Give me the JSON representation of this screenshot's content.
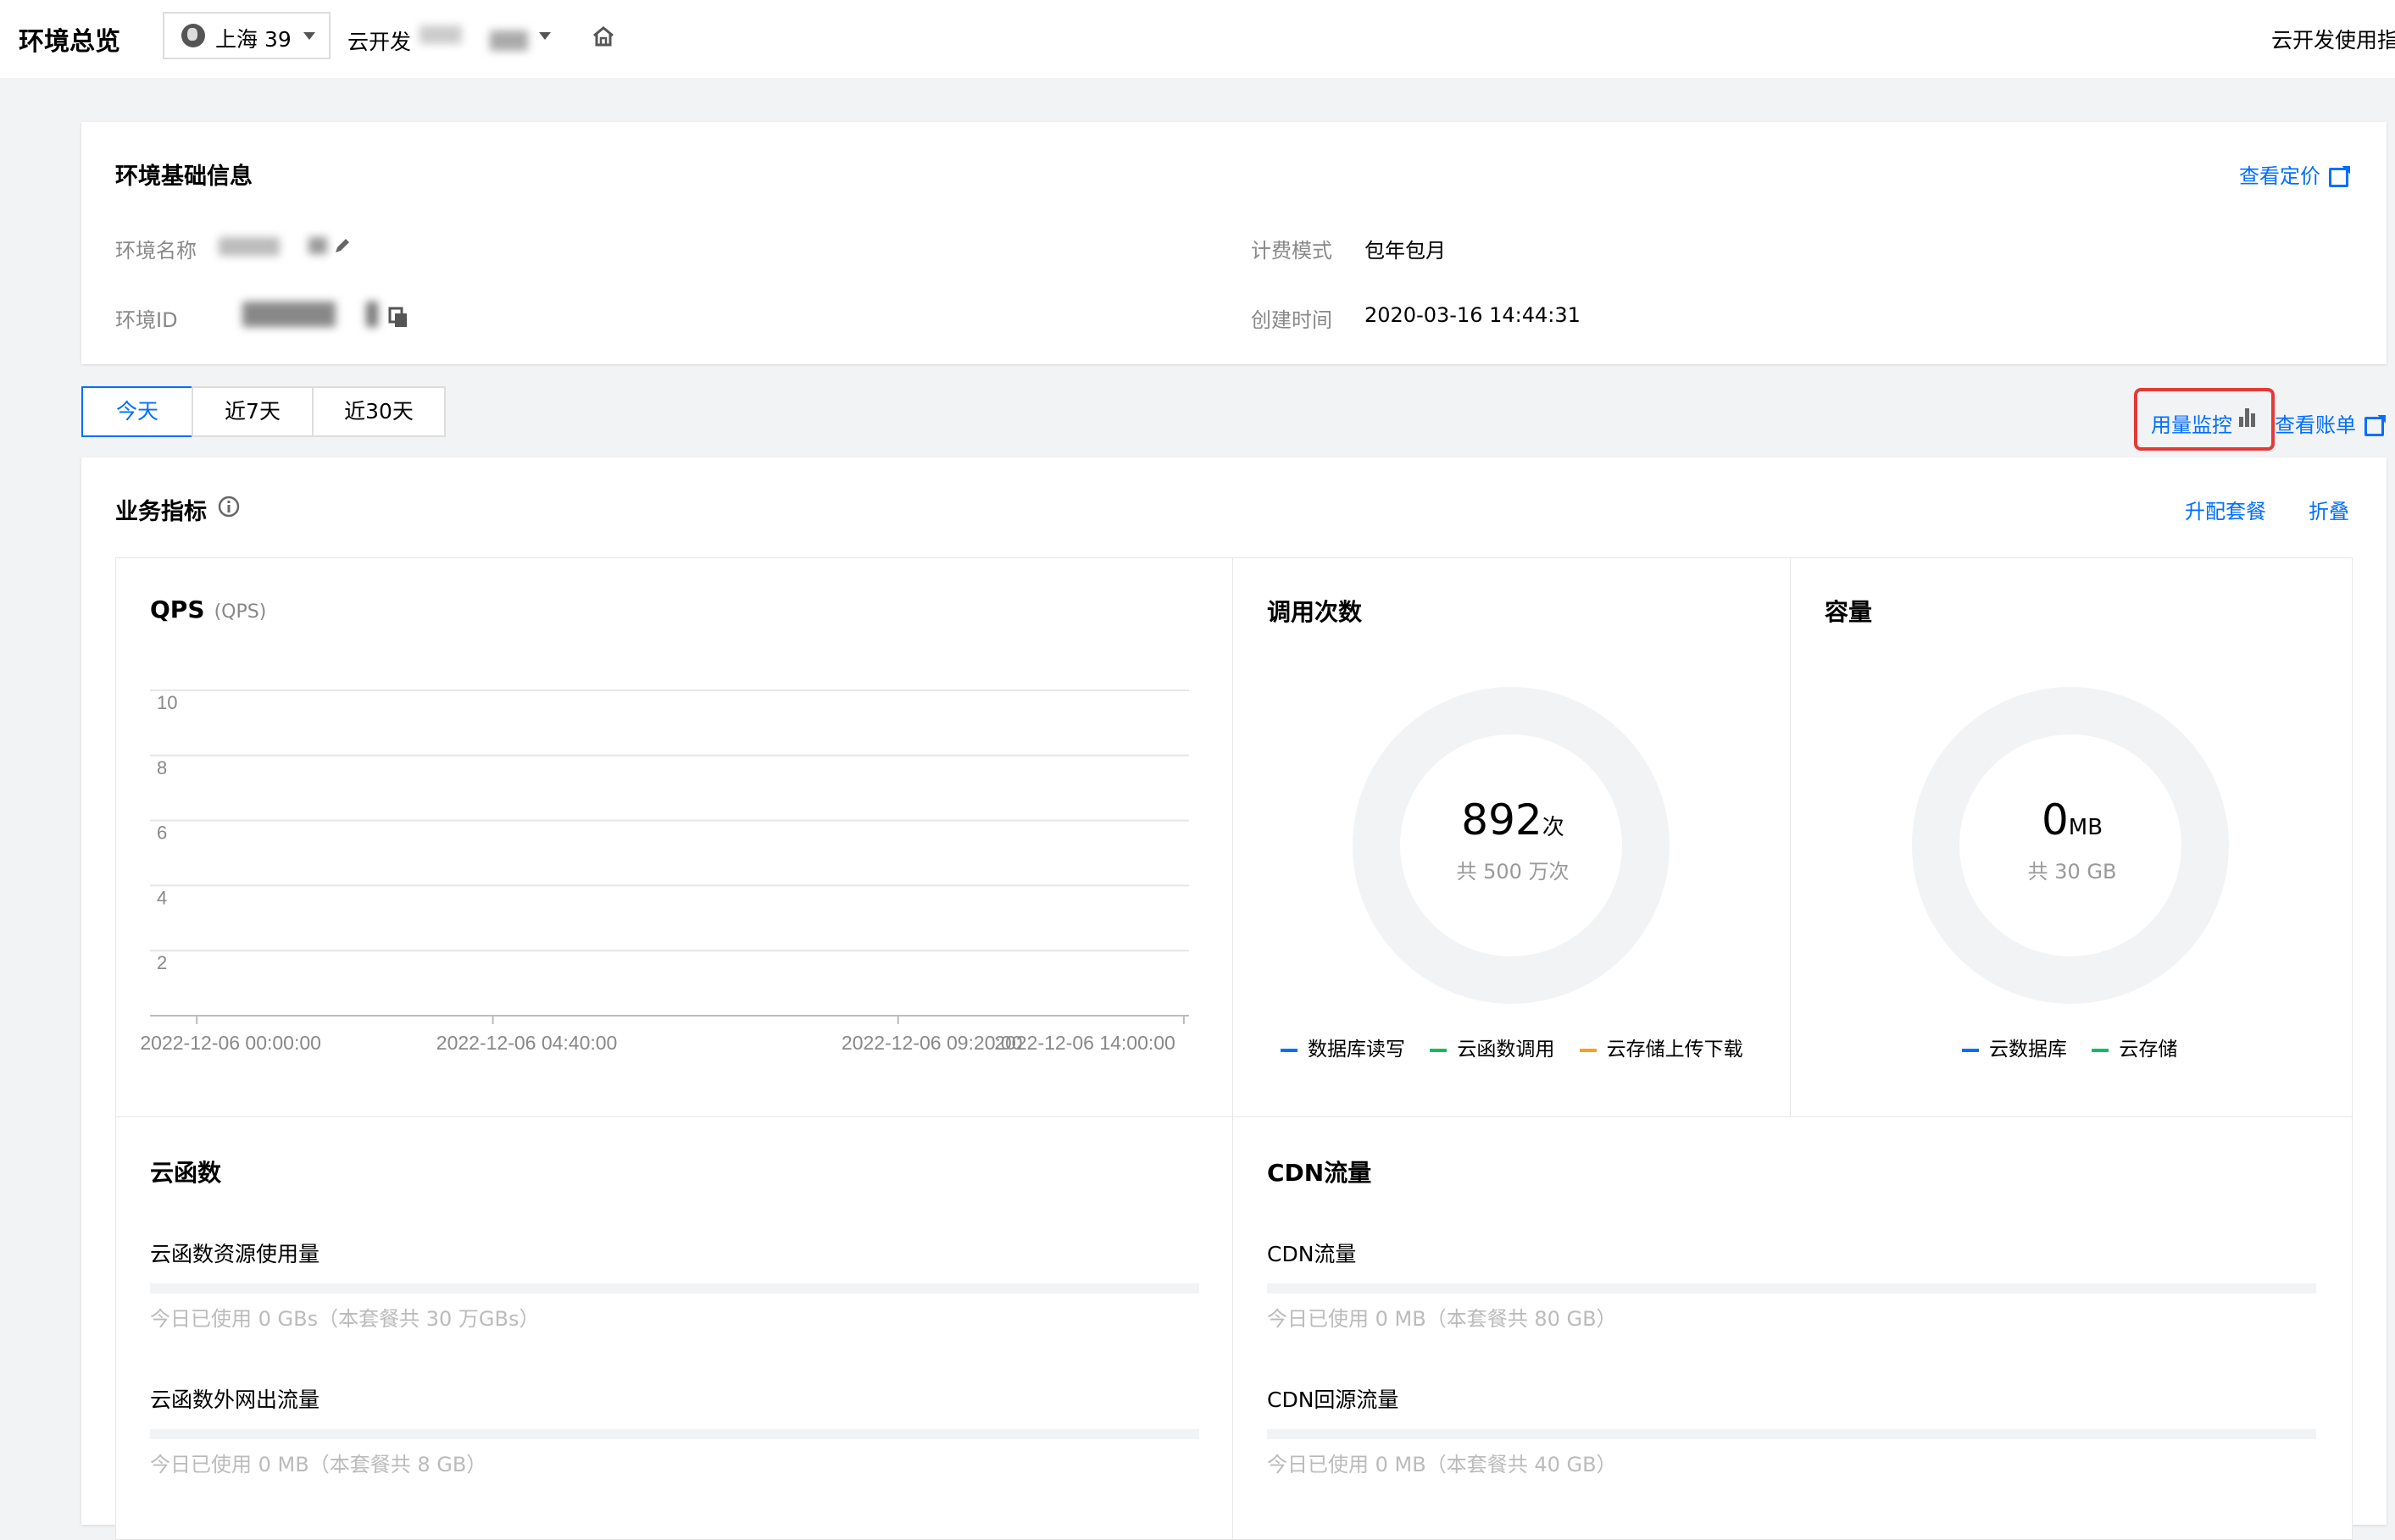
{
  "header": {
    "title": "环境总览",
    "region": "上海 39",
    "env_label": "云开发",
    "guide_link": "云开发使用指"
  },
  "basic_info": {
    "title": "环境基础信息",
    "pricing_link": "查看定价",
    "env_name_label": "环境名称",
    "env_id_label": "环境ID",
    "billing_label": "计费模式",
    "billing_value": "包年包月",
    "created_label": "创建时间",
    "created_value": "2020-03-16 14:44:31"
  },
  "tabs": [
    "今天",
    "近7天",
    "近30天"
  ],
  "actions": {
    "usage_monitor": "用量监控",
    "view_bill": "查看账单"
  },
  "business": {
    "title": "业务指标",
    "upgrade": "升配套餐",
    "collapse": "折叠"
  },
  "qps": {
    "title": "QPS",
    "unit": "(QPS)"
  },
  "chart_data": {
    "type": "line",
    "title": "QPS",
    "ylabel": "",
    "ylim": [
      0,
      10
    ],
    "yticks": [
      2,
      4,
      6,
      8,
      10
    ],
    "x_ticks": [
      "2022-12-06 00:00:00",
      "2022-12-06 04:40:00",
      "2022-12-06 09:20:00",
      "2022-12-06 14:00:00"
    ],
    "series": []
  },
  "calls": {
    "title": "调用次数",
    "value": "892",
    "unit": "次",
    "total": "共 500 万次",
    "legend": [
      {
        "label": "数据库读写",
        "color": "#006eff"
      },
      {
        "label": "云函数调用",
        "color": "#0abf5b"
      },
      {
        "label": "云存储上传下载",
        "color": "#ff9c19"
      }
    ]
  },
  "capacity": {
    "title": "容量",
    "value": "0",
    "unit": "MB",
    "total": "共 30 GB",
    "legend": [
      {
        "label": "云数据库",
        "color": "#006eff"
      },
      {
        "label": "云存储",
        "color": "#0abf5b"
      }
    ]
  },
  "functions": {
    "title": "云函数",
    "items": [
      {
        "label": "云函数资源使用量",
        "usage": "今日已使用 0 GBs（本套餐共 30 万GBs）",
        "ratio": 0
      },
      {
        "label": "云函数外网出流量",
        "usage": "今日已使用 0 MB（本套餐共 8 GB）",
        "ratio": 0
      }
    ]
  },
  "cdn": {
    "title": "CDN流量",
    "items": [
      {
        "label": "CDN流量",
        "usage": "今日已使用 0 MB（本套餐共 80 GB）",
        "ratio": 0
      },
      {
        "label": "CDN回源流量",
        "usage": "今日已使用 0 MB（本套餐共 40 GB）",
        "ratio": 0
      }
    ]
  }
}
